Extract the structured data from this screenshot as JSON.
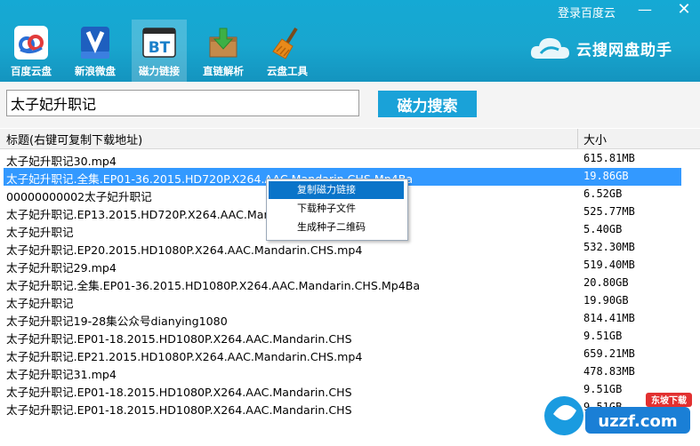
{
  "window": {
    "login_label": "登录百度云",
    "minimize_glyph": "—",
    "close_glyph": "✕"
  },
  "toolbar": {
    "items": [
      {
        "label": "百度云盘",
        "icon": "baidu-cloud-icon"
      },
      {
        "label": "新浪微盘",
        "icon": "sina-vdisk-icon"
      },
      {
        "label": "磁力链接",
        "icon": "bt-icon",
        "active": true
      },
      {
        "label": "直链解析",
        "icon": "download-box-icon"
      },
      {
        "label": "云盘工具",
        "icon": "broom-icon"
      }
    ]
  },
  "brand": {
    "name": "云搜网盘助手",
    "icon": "cloud-logo-icon"
  },
  "search": {
    "query": "太子妃升职记",
    "button_label": "磁力搜索"
  },
  "table": {
    "columns": {
      "title": "标题(右键可复制下载地址)",
      "size": "大小"
    },
    "rows": [
      {
        "title": "太子妃升职记30.mp4",
        "size": "615.81MB"
      },
      {
        "title": "太子妃升职记.全集.EP01-36.2015.HD720P.X264.AAC.Mandarin.CHS.Mp4Ba",
        "size": "19.86GB",
        "selected": true
      },
      {
        "title": "00000000002太子妃升职记",
        "size": "6.52GB"
      },
      {
        "title": "太子妃升职记.EP13.2015.HD720P.X264.AAC.Mandarin.CHS.mp4",
        "size": "525.77MB"
      },
      {
        "title": "太子妃升职记",
        "size": "5.40GB"
      },
      {
        "title": "太子妃升职记.EP20.2015.HD1080P.X264.AAC.Mandarin.CHS.mp4",
        "size": "532.30MB"
      },
      {
        "title": "太子妃升职记29.mp4",
        "size": "519.40MB"
      },
      {
        "title": "太子妃升职记.全集.EP01-36.2015.HD1080P.X264.AAC.Mandarin.CHS.Mp4Ba",
        "size": "20.80GB"
      },
      {
        "title": "太子妃升职记",
        "size": "19.90GB"
      },
      {
        "title": "太子妃升职记19-28集公众号dianying1080",
        "size": "814.41MB"
      },
      {
        "title": "太子妃升职记.EP01-18.2015.HD1080P.X264.AAC.Mandarin.CHS",
        "size": "9.51GB"
      },
      {
        "title": "太子妃升职记.EP21.2015.HD1080P.X264.AAC.Mandarin.CHS.mp4",
        "size": "659.21MB"
      },
      {
        "title": "太子妃升职记31.mp4",
        "size": "478.83MB"
      },
      {
        "title": "太子妃升职记.EP01-18.2015.HD1080P.X264.AAC.Mandarin.CHS",
        "size": "9.51GB"
      },
      {
        "title": "太子妃升职记.EP01-18.2015.HD1080P.X264.AAC.Mandarin.CHS",
        "size": "9.51GB"
      }
    ]
  },
  "context_menu": {
    "items": [
      {
        "label": "复制磁力链接",
        "hover": true
      },
      {
        "label": "下载种子文件"
      },
      {
        "label": "生成种子二维码"
      }
    ]
  },
  "watermark": {
    "text": "uzzf.com",
    "sub": "东坡下载"
  },
  "colors": {
    "header": "#18a6cf",
    "selection": "#3399ff",
    "button": "#1aa2d8"
  }
}
